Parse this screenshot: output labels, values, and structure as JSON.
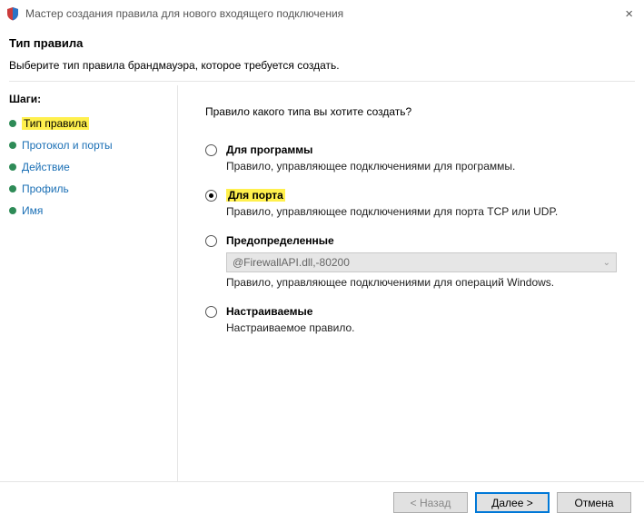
{
  "window": {
    "title": "Мастер создания правила для нового входящего подключения"
  },
  "header": {
    "title": "Тип правила",
    "subtitle": "Выберите тип правила брандмауэра, которое требуется создать."
  },
  "sidebar": {
    "steps_label": "Шаги:",
    "steps": [
      {
        "label": "Тип правила"
      },
      {
        "label": "Протокол и порты"
      },
      {
        "label": "Действие"
      },
      {
        "label": "Профиль"
      },
      {
        "label": "Имя"
      }
    ]
  },
  "main": {
    "prompt": "Правило какого типа вы хотите создать?",
    "options": {
      "program": {
        "label": "Для программы",
        "desc": "Правило, управляющее подключениями для программы."
      },
      "port": {
        "label": "Для порта",
        "desc": "Правило, управляющее подключениями для порта TCP или UDP."
      },
      "predefined": {
        "label": "Предопределенные",
        "combo_value": "@FirewallAPI.dll,-80200",
        "desc": "Правило, управляющее подключениями для операций Windows."
      },
      "custom": {
        "label": "Настраиваемые",
        "desc": "Настраиваемое правило."
      }
    }
  },
  "footer": {
    "back": "< Назад",
    "next": "Далее >",
    "cancel": "Отмена"
  }
}
